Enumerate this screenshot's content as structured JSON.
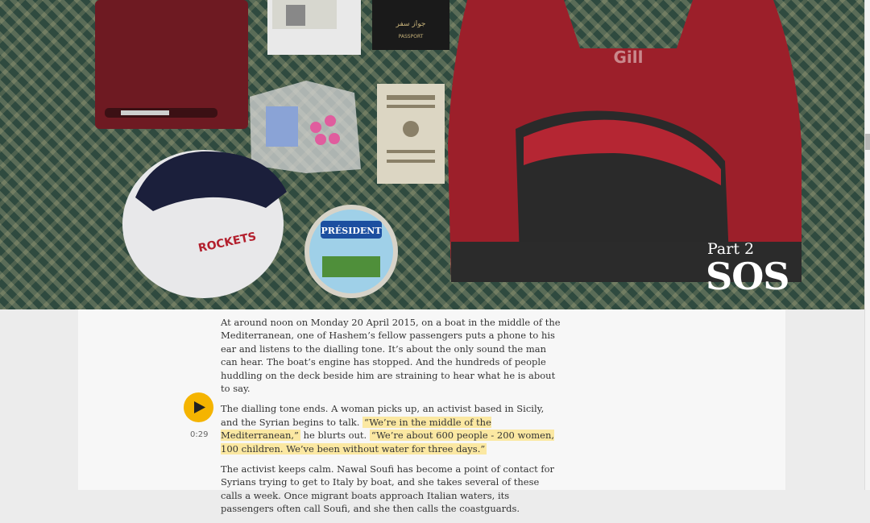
{
  "hero": {
    "part_label": "Part 2",
    "part_title": "SOS",
    "passport_text": "PASSPORT",
    "passport_arabic": "جواز سفر",
    "brand_text": "Gill",
    "cheese_brand": "PRÉSIDENT",
    "cap_text": "ROCKETS"
  },
  "audio": {
    "time": "0:29",
    "accent": "#f5b400"
  },
  "article": {
    "p1": "At around noon on Monday 20 April 2015, on a boat in the middle of the Mediterranean, one of Hashem’s fellow passengers puts a phone to his ear and listens to the dialling tone. It’s about the only sound the man can hear. The boat’s engine has stopped. And the hundreds of people huddling on the deck beside him are straining to hear what he is about to say.",
    "p2_a": "The dialling tone ends. A woman picks up, an activist based in Sicily, and the Syrian begins to talk.",
    "p2_quote1": "“We’re in the middle of the Mediterranean,”",
    "p2_b": "he blurts out.",
    "p2_quote2": "“We’re about 600 people - 200 women, 100 children. We’ve been without water for three days.”",
    "p3": "The activist keeps calm. Nawal Soufi has become a point of contact for Syrians trying to get to Italy by boat, and she takes several of these calls a week. Once migrant boats approach Italian waters, its passengers often call Soufi, and she then calls the coastguards."
  }
}
